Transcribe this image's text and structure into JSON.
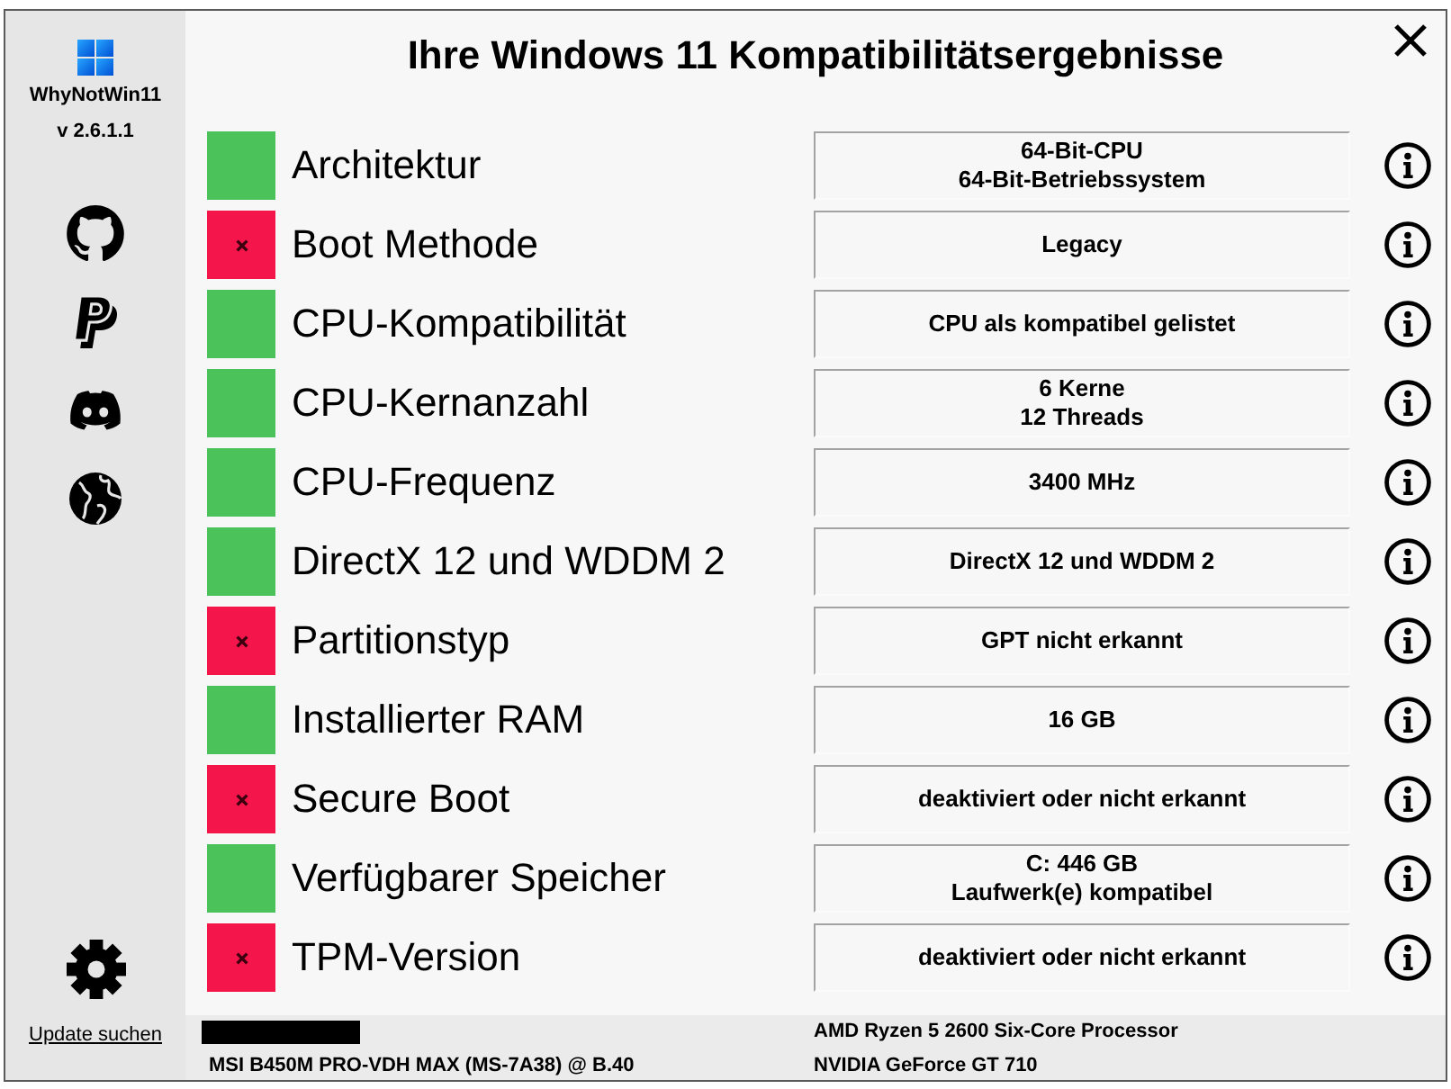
{
  "window": {
    "title": "Ihre Windows 11 Kompatibilitätsergebnisse"
  },
  "sidebar": {
    "app_name": "WhyNotWin11",
    "version": "v 2.6.1.1",
    "update_link": "Update suchen"
  },
  "checks": [
    {
      "name": "Architektur",
      "passed": true,
      "result": "64-Bit-CPU\n64-Bit-Betriebssystem"
    },
    {
      "name": "Boot Methode",
      "passed": false,
      "result": "Legacy"
    },
    {
      "name": "CPU-Kompatibilität",
      "passed": true,
      "result": "CPU als kompatibel gelistet"
    },
    {
      "name": "CPU-Kernanzahl",
      "passed": true,
      "result": "6 Kerne\n12 Threads"
    },
    {
      "name": "CPU-Frequenz",
      "passed": true,
      "result": "3400 MHz"
    },
    {
      "name": "DirectX 12 und WDDM 2",
      "passed": true,
      "result": "DirectX 12 und WDDM 2"
    },
    {
      "name": "Partitionstyp",
      "passed": false,
      "result": "GPT nicht erkannt"
    },
    {
      "name": "Installierter RAM",
      "passed": true,
      "result": "16 GB"
    },
    {
      "name": "Secure Boot",
      "passed": false,
      "result": "deaktiviert oder nicht erkannt"
    },
    {
      "name": "Verfügbarer Speicher",
      "passed": true,
      "result": "C: 446 GB\nLaufwerk(e) kompatibel"
    },
    {
      "name": "TPM-Version",
      "passed": false,
      "result": "deaktiviert oder nicht erkannt"
    }
  ],
  "status_bar": {
    "motherboard": "MSI B450M PRO-VDH MAX (MS-7A38) @ B.40",
    "cpu": "AMD Ryzen 5 2600 Six-Core Processor",
    "gpu": "NVIDIA GeForce GT 710"
  }
}
